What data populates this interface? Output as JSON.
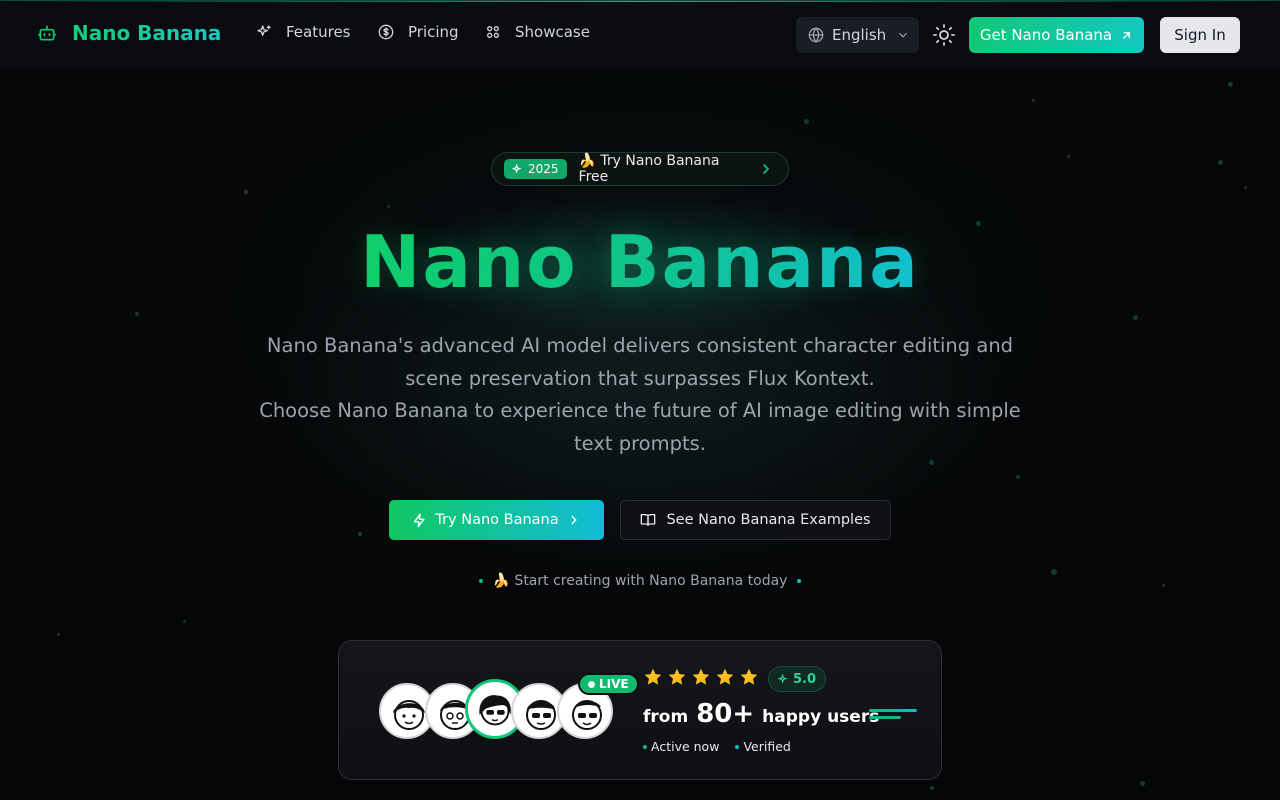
{
  "nav": {
    "brand": "Nano Banana",
    "links": [
      {
        "label": "Features",
        "icon": "sparkles-icon"
      },
      {
        "label": "Pricing",
        "icon": "dollar-circle-icon"
      },
      {
        "label": "Showcase",
        "icon": "grid-icon"
      }
    ],
    "language": "English",
    "theme_icon": "sun-icon",
    "get_button": "Get Nano Banana",
    "signin_button": "Sign In"
  },
  "hero": {
    "badge_year": "2025",
    "badge_text": "🍌 Try Nano Banana Free",
    "title": "Nano Banana",
    "subtitle_line1": "Nano Banana's advanced AI model delivers consistent character editing and scene preservation that surpasses Flux Kontext.",
    "subtitle_line2": "Choose Nano Banana to experience the future of AI image editing with simple text prompts.",
    "cta_primary": "Try Nano Banana",
    "cta_secondary": "See Nano Banana Examples",
    "start_text": "🍌 Start creating with Nano Banana today"
  },
  "social": {
    "live_label": "LIVE",
    "stars": 5,
    "rating": "5.0",
    "from_label": "from",
    "user_count": "80+",
    "users_label": "happy users",
    "meta_active": "Active now",
    "meta_verified": "Verified"
  },
  "colors": {
    "accent_green": "#10c777",
    "accent_cyan": "#14c8c0",
    "star": "#fbbf24",
    "background": "#050607"
  }
}
